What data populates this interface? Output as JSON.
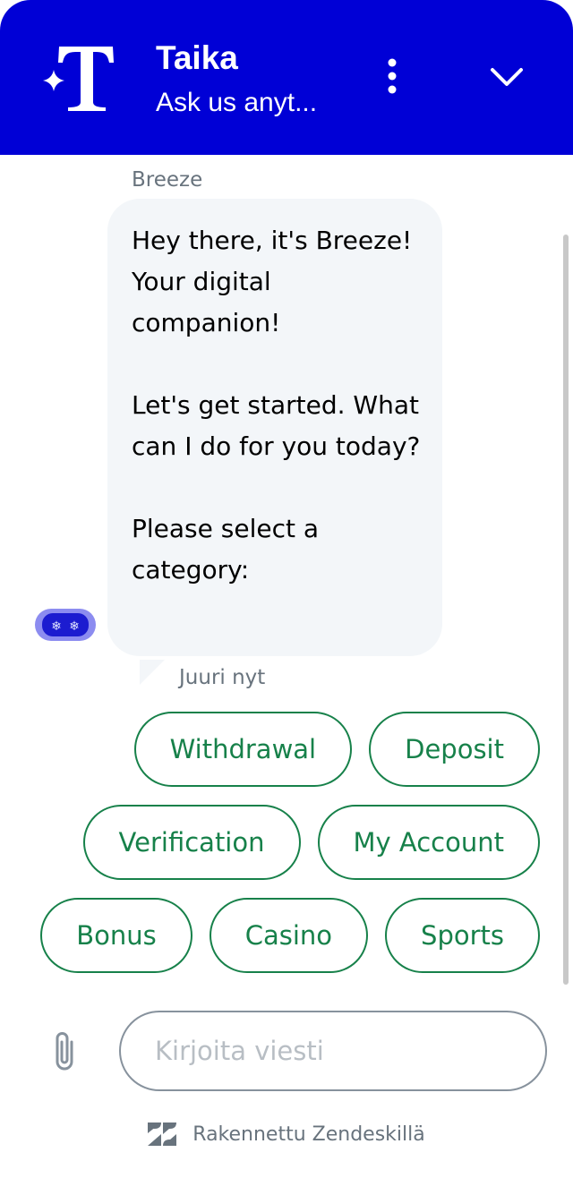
{
  "header": {
    "title": "Taika",
    "subtitle": "Ask us anyt...",
    "logo_letter": "T",
    "brand_color": "#0000d6",
    "more_icon": "vertical-ellipsis",
    "collapse_icon": "chevron-down"
  },
  "conversation": {
    "sender": "Breeze",
    "message": "Hey there, it's Breeze! Your digital companion!\n\nLet's get started. What can I do for you today?\n\nPlease select a category:",
    "timestamp": "Juuri nyt",
    "avatar_icon": "robot-snowflake-eyes"
  },
  "quick_replies": [
    "Withdrawal",
    "Deposit",
    "Verification",
    "My Account",
    "Bonus",
    "Casino",
    "Sports"
  ],
  "quick_reply_color": "#17814a",
  "composer": {
    "placeholder": "Kirjoita viesti",
    "value": "",
    "attach_icon": "paperclip"
  },
  "footer": {
    "text": "Rakennettu Zendeskillä",
    "logo_icon": "zendesk-logo"
  }
}
